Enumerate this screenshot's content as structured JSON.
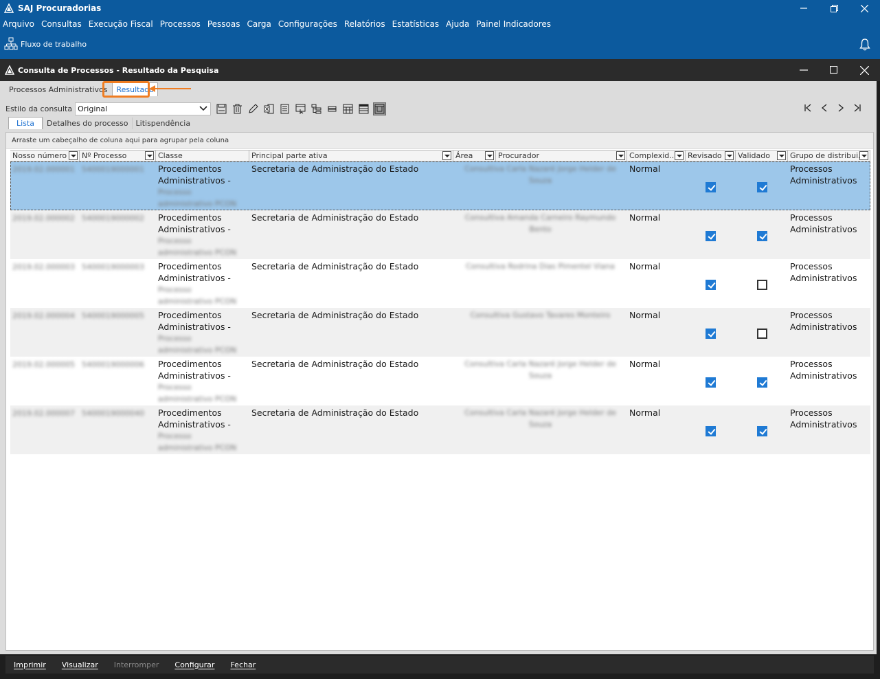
{
  "app": {
    "title": "SAJ Procuradorias",
    "menu": [
      "Arquivo",
      "Consultas",
      "Execução Fiscal",
      "Processos",
      "Pessoas",
      "Carga",
      "Configurações",
      "Relatórios",
      "Estatísticas",
      "Ajuda",
      "Painel Indicadores"
    ],
    "workflow_label": "Fluxo de trabalho"
  },
  "window": {
    "title": "Consulta de Processos - Resultado da Pesquisa",
    "top_tabs": [
      "Processos Administrativos",
      "Resultado"
    ],
    "style_label": "Estilo da consulta",
    "style_value": "Original",
    "sub_tabs": [
      "Lista",
      "Detalhes do processo",
      "Litispendência"
    ],
    "group_hint": "Arraste um cabeçalho de coluna aqui para agrupar pela coluna"
  },
  "grid": {
    "columns": [
      "Nosso número",
      "Nº Processo",
      "Classe",
      "Principal parte ativa",
      "Área",
      "Procurador",
      "Complexid...",
      "Revisado",
      "Validado",
      "Grupo de distribui..."
    ],
    "rows": [
      {
        "nosso": "2019.02.000001",
        "processo": "5400019000001",
        "classe1": "Procedimentos",
        "classe2": "Administrativos -",
        "classe3": "Processo",
        "classe4": "administrativo PCON",
        "parte": "Secretaria de Administração do Estado",
        "proc1": "Consultiva Carla Nazaré Jorge Helder de",
        "proc2": "Souza",
        "complex": "Normal",
        "revisado": true,
        "validado": true,
        "grupo1": "Processos",
        "grupo2": "Administrativos"
      },
      {
        "nosso": "2019.02.000002",
        "processo": "5400019000002",
        "classe1": "Procedimentos",
        "classe2": "Administrativos -",
        "classe3": "Processo",
        "classe4": "administrativo PCON",
        "parte": "Secretaria de Administração do Estado",
        "proc1": "Consultiva Amanda Carneiro Raymundo",
        "proc2": "Bento",
        "complex": "Normal",
        "revisado": true,
        "validado": true,
        "grupo1": "Processos",
        "grupo2": "Administrativos"
      },
      {
        "nosso": "2019.02.000003",
        "processo": "5400019000003",
        "classe1": "Procedimentos",
        "classe2": "Administrativos -",
        "classe3": "Processo",
        "classe4": "administrativo PCON",
        "parte": "Secretaria de Administração do Estado",
        "proc1": "Consultiva Rodrina Dias Pimentel Viana",
        "proc2": "",
        "complex": "Normal",
        "revisado": true,
        "validado": false,
        "grupo1": "Processos",
        "grupo2": "Administrativos"
      },
      {
        "nosso": "2019.02.000004",
        "processo": "5400019000005",
        "classe1": "Procedimentos",
        "classe2": "Administrativos -",
        "classe3": "Processo",
        "classe4": "administrativo PCON",
        "parte": "Secretaria de Administração do Estado",
        "proc1": "Consultiva Gustavo Tavares Monteiro",
        "proc2": "",
        "complex": "Normal",
        "revisado": true,
        "validado": false,
        "grupo1": "Processos",
        "grupo2": "Administrativos"
      },
      {
        "nosso": "2019.02.000005",
        "processo": "5400019000006",
        "classe1": "Procedimentos",
        "classe2": "Administrativos -",
        "classe3": "Processo",
        "classe4": "administrativo PCON",
        "parte": "Secretaria de Administração do Estado",
        "proc1": "Consultiva Carla Nazaré Jorge Helder de",
        "proc2": "Souza",
        "complex": "Normal",
        "revisado": true,
        "validado": true,
        "grupo1": "Processos",
        "grupo2": "Administrativos"
      },
      {
        "nosso": "2019.02.000007",
        "processo": "5400019000040",
        "classe1": "Procedimentos",
        "classe2": "Administrativos -",
        "classe3": "Processo",
        "classe4": "administrativo PCON",
        "parte": "Secretaria de Administração do Estado",
        "proc1": "Consultiva Carla Nazaré Jorge Helder de",
        "proc2": "Souza",
        "complex": "Normal",
        "revisado": true,
        "validado": true,
        "grupo1": "Processos",
        "grupo2": "Administrativos"
      }
    ]
  },
  "bottom_bar": [
    "Imprimir",
    "Visualizar",
    "Interromper",
    "Configurar",
    "Fechar"
  ],
  "colors": {
    "title_blue": "#0c5a9e",
    "selected_row": "#9dc7ea",
    "highlight": "#ef7d22",
    "checkbox": "#1f7ad4"
  }
}
